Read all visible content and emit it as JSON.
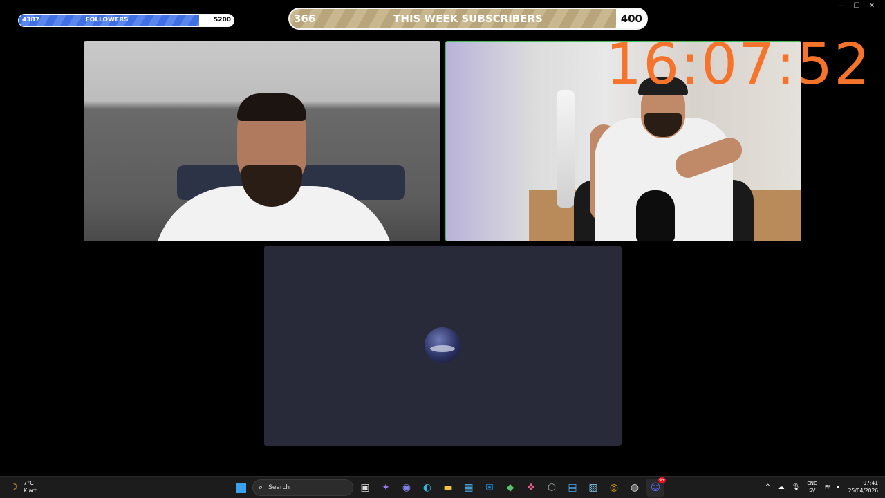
{
  "window_controls": {
    "minimize": "—",
    "maximize": "☐",
    "close": "✕"
  },
  "followers_bar": {
    "current": "4387",
    "label": "FOLLOWERS",
    "goal": "5200",
    "progress": 0.84
  },
  "subscribers_bar": {
    "current": "366",
    "label": "THIS WEEK SUBSCRIBERS",
    "goal": "400",
    "progress": 0.915
  },
  "clock": {
    "time": "16:07:52"
  },
  "taskbar": {
    "weather_temp": "7°C",
    "weather_desc": "Klart",
    "search_placeholder": "Search",
    "lang_top": "ENG",
    "lang_bottom": "SV",
    "time": "07:41",
    "date": "25/04/2026",
    "discord_badge": "9+"
  },
  "colors": {
    "accent_green": "#3bbf5c",
    "clock_orange": "#f5732a",
    "followers_blue": "#4a78e6",
    "subs_tan": "#c2b088"
  }
}
